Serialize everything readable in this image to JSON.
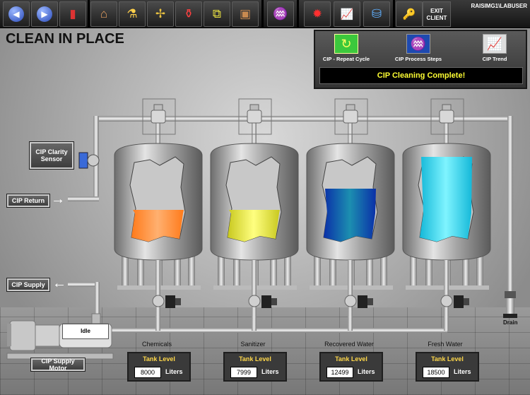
{
  "toolbar": {
    "buttons": [
      {
        "name": "back-button",
        "icon": "back-arrow-icon",
        "glyph": "◀"
      },
      {
        "name": "forward-button",
        "icon": "forward-arrow-icon",
        "glyph": "▶"
      },
      {
        "name": "inventory-button",
        "icon": "cylinder-icon",
        "glyph": "▮"
      },
      {
        "name": "plant-button",
        "icon": "factory-icon",
        "glyph": "⌂"
      },
      {
        "name": "lab-button",
        "icon": "flask-icon",
        "glyph": "⚗"
      },
      {
        "name": "fan-button",
        "icon": "fan-icon",
        "glyph": "✢"
      },
      {
        "name": "reagent-button",
        "icon": "bottle-icon",
        "glyph": "⚱"
      },
      {
        "name": "process-button",
        "icon": "process-icon",
        "glyph": "⧉"
      },
      {
        "name": "package-button",
        "icon": "box-icon",
        "glyph": "▣"
      },
      {
        "name": "cip-button",
        "icon": "wash-icon",
        "glyph": "♒"
      },
      {
        "name": "alarm-button",
        "icon": "alarm-icon",
        "glyph": "✹"
      },
      {
        "name": "trend-button",
        "icon": "trend-icon",
        "glyph": "📈"
      },
      {
        "name": "network-button",
        "icon": "network-icon",
        "glyph": "⛁"
      },
      {
        "name": "login-button",
        "icon": "key-icon",
        "glyph": "🔑"
      }
    ],
    "exit_line1": "EXIT",
    "exit_line2": "CLIENT",
    "user": "RAISIMG1\\LABUSER"
  },
  "page": {
    "title": "CLEAN IN PLACE"
  },
  "cip_panel": {
    "repeat_label": "CIP - Repeat Cycle",
    "steps_label": "CIP Process Steps",
    "trend_label": "CIP Trend",
    "status": "CIP Cleaning Complete!"
  },
  "labels": {
    "clarity_sensor": "CIP Clarity Sensor",
    "cip_return": "CIP Return",
    "cip_supply": "CIP Supply",
    "supply_motor": "CIP Supply Motor",
    "motor_status": "Idle",
    "drain": "Drain"
  },
  "tanks": [
    {
      "name": "Chemicals",
      "level_title": "Tank Level",
      "level": "8000",
      "unit": "Liters",
      "color": "#ff8a2a"
    },
    {
      "name": "Sanitizer",
      "level_title": "Tank Level",
      "level": "7999",
      "unit": "Liters",
      "color": "#e8e83a"
    },
    {
      "name": "Recovered Water",
      "level_title": "Tank Level",
      "level": "12499",
      "unit": "Liters",
      "color": "#1040c8"
    },
    {
      "name": "Fresh Water",
      "level_title": "Tank Level",
      "level": "18500",
      "unit": "Liters",
      "color": "#20d8e8"
    }
  ]
}
